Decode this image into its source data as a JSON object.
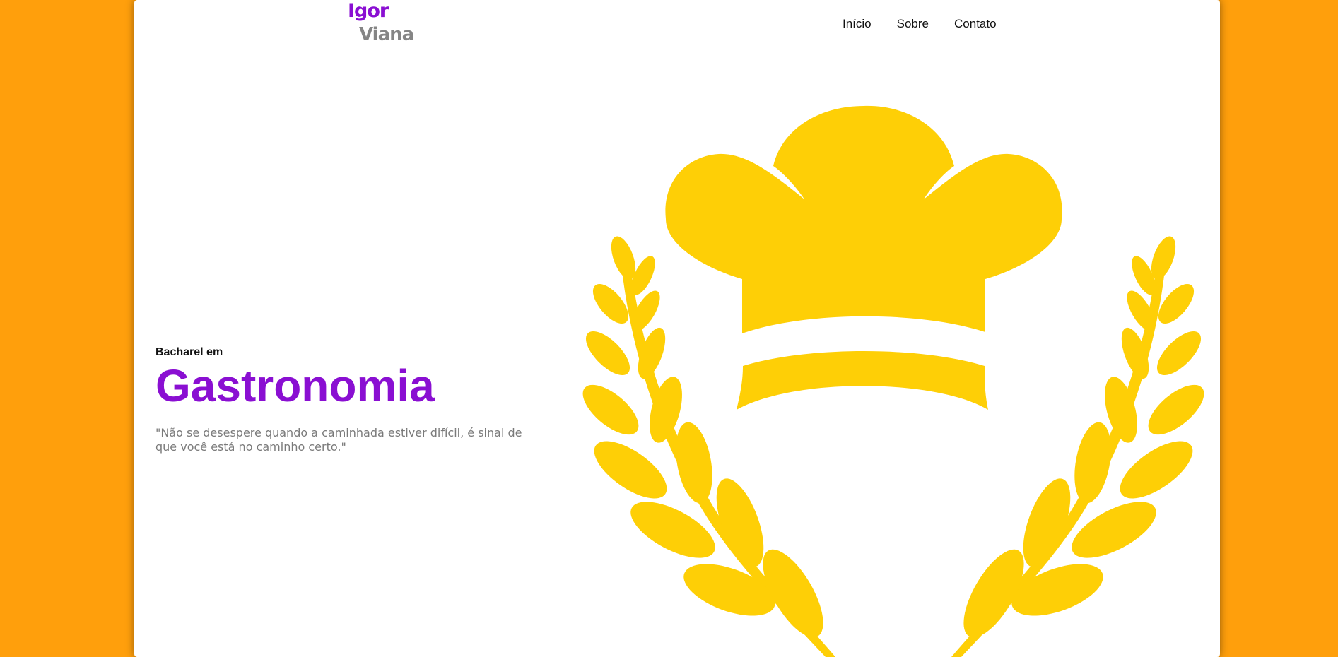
{
  "brand": {
    "first": "Igor",
    "last": "Viana",
    "first_color": "#8a0fd2",
    "last_color": "#858585"
  },
  "nav": {
    "items": [
      "Início",
      "Sobre",
      "Contato"
    ]
  },
  "hero": {
    "subtitle": "Bacharel em",
    "title": "Gastronomia",
    "quote": "\"Não se desespere quando a caminhada estiver difícil, é sinal de que você está no caminho certo.\"",
    "title_color": "#8a0fd2"
  },
  "illustration": {
    "icon": "chef-hat-laurel-icon",
    "color": "#fecf06"
  },
  "theme": {
    "background": "#ff9f0c",
    "card": "#ffffff"
  }
}
